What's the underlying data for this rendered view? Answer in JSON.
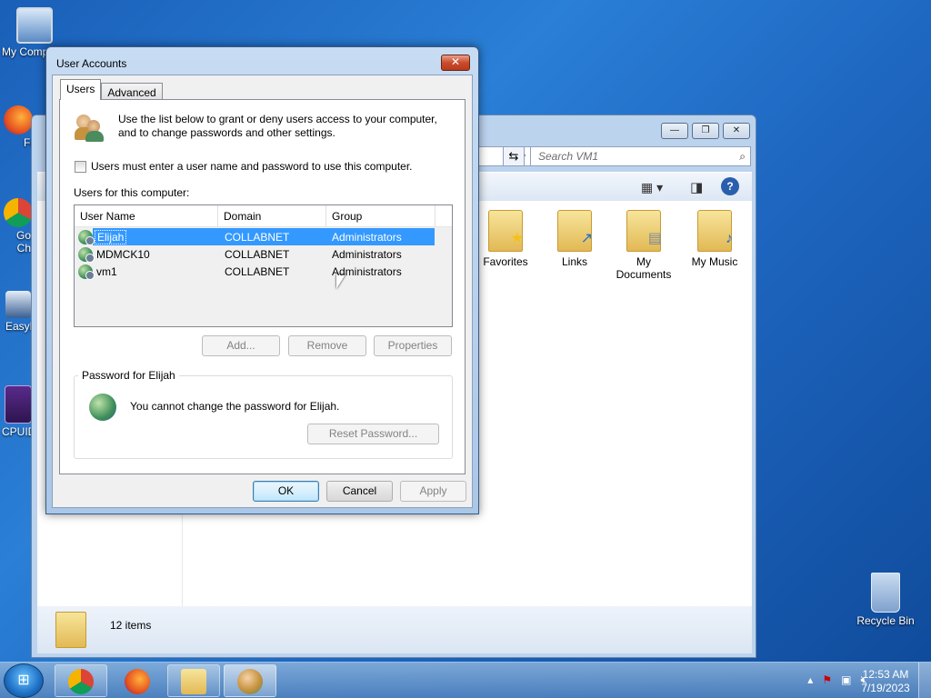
{
  "desktop": {
    "icons": [
      {
        "label": "My Comp",
        "icon": "computer-icon"
      },
      {
        "label": "Fi",
        "icon": "firefox-shortcut-icon"
      },
      {
        "label": "Go\nCh",
        "icon": "chrome-shortcut-icon"
      },
      {
        "label": "EasyB",
        "icon": "easybcd-shortcut-icon"
      },
      {
        "label": "CPUID",
        "icon": "cpuid-shortcut-icon"
      },
      {
        "label": "Recycle Bin",
        "icon": "recycle-bin-icon"
      }
    ]
  },
  "explorer": {
    "search_placeholder": "Search VM1",
    "folders": [
      {
        "label": "Favorites",
        "icon": "favorites-folder-icon"
      },
      {
        "label": "Links",
        "icon": "links-folder-icon"
      },
      {
        "label": "My Documents",
        "icon": "documents-folder-icon"
      },
      {
        "label": "My Music",
        "icon": "music-folder-icon"
      }
    ],
    "status_count": "12 items"
  },
  "dialog": {
    "title": "User Accounts",
    "close_label": "✕",
    "tabs": [
      {
        "label": "Users",
        "active": true
      },
      {
        "label": "Advanced",
        "active": false
      }
    ],
    "intro_text": "Use the list below to grant or deny users access to your computer, and to change passwords and other settings.",
    "checkbox_label": "Users must enter a user name and password to use this computer.",
    "checkbox_checked": false,
    "users_label": "Users for this computer:",
    "columns": [
      "User Name",
      "Domain",
      "Group"
    ],
    "users": [
      {
        "name": "Elijah",
        "domain": "COLLABNET",
        "group": "Administrators",
        "selected": true
      },
      {
        "name": "MDMCK10",
        "domain": "COLLABNET",
        "group": "Administrators",
        "selected": false
      },
      {
        "name": "vm1",
        "domain": "COLLABNET",
        "group": "Administrators",
        "selected": false
      }
    ],
    "buttons": {
      "add": "Add...",
      "remove": "Remove",
      "properties": "Properties"
    },
    "password_group_title": "Password for Elijah",
    "password_text": "You cannot change the password for Elijah.",
    "reset_password": "Reset Password...",
    "ok": "OK",
    "cancel": "Cancel",
    "apply": "Apply"
  },
  "taskbar": {
    "items": [
      {
        "icon": "chrome-icon"
      },
      {
        "icon": "firefox-icon"
      },
      {
        "icon": "file-explorer-icon"
      },
      {
        "icon": "user-accounts-icon"
      }
    ],
    "time": "12:53 AM",
    "date": "7/19/2023"
  }
}
